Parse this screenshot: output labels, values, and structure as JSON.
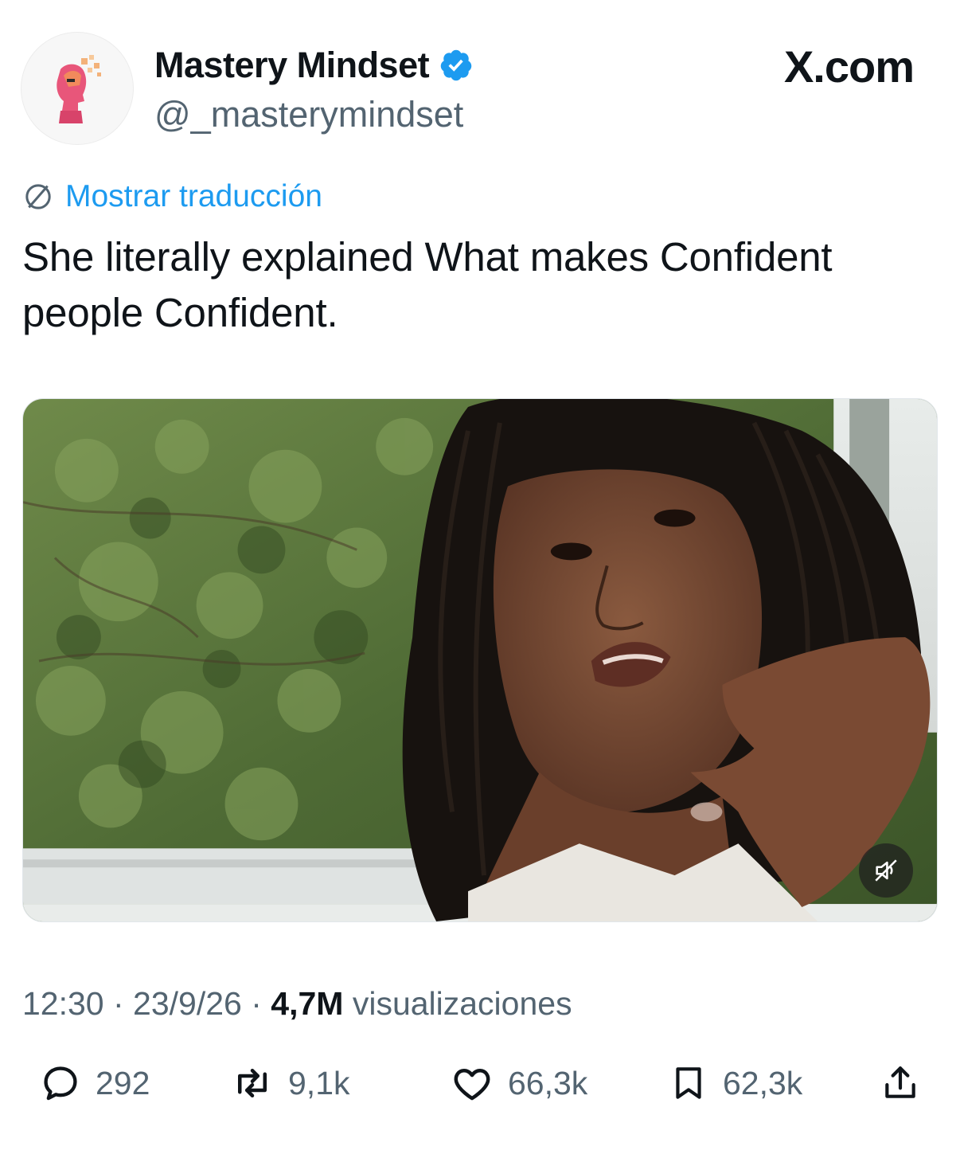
{
  "author": {
    "display_name": "Mastery Mindset",
    "handle": "@_masterymindset",
    "verified": true,
    "avatar_icon": "mastery-mindset-logo"
  },
  "site_label": "X.com",
  "translate": {
    "icon": "globe-icon",
    "label": "Mostrar traducción"
  },
  "tweet": {
    "text": "She literally explained What makes Confident people Confident."
  },
  "media": {
    "type": "video",
    "muted": true,
    "mute_icon": "speaker-muted-icon"
  },
  "meta": {
    "time": "12:30",
    "separator_1": " · ",
    "date": "23/9/26",
    "separator_2": " · ",
    "views_count": "4,7M",
    "views_label": " visualizaciones"
  },
  "actions": {
    "reply": {
      "count": "292",
      "icon": "reply-icon"
    },
    "repost": {
      "count": "9,1k",
      "icon": "repost-icon"
    },
    "like": {
      "count": "66,3k",
      "icon": "heart-icon"
    },
    "bookmark": {
      "count": "62,3k",
      "icon": "bookmark-icon"
    },
    "share": {
      "icon": "share-icon"
    }
  },
  "colors": {
    "link": "#1d9bf0",
    "verified_badge": "#1d9bf0",
    "text_primary": "#0f1419",
    "text_secondary": "#536471"
  }
}
